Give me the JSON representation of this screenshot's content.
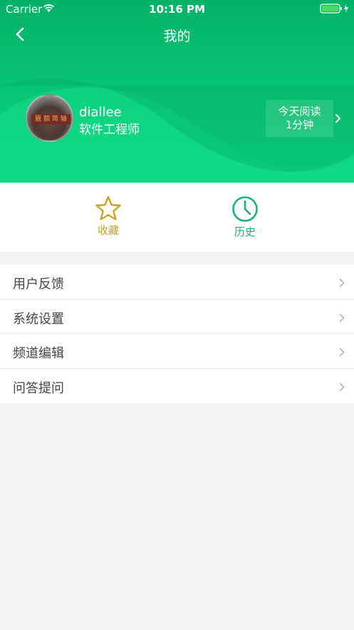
{
  "status_bar": {
    "carrier": "Carrier",
    "time": "10:16 PM"
  },
  "nav": {
    "title": "我的",
    "back_icon": "chevron-left-icon"
  },
  "profile": {
    "username": "diallee",
    "title": "软件工程师",
    "avatar_sign_text": "匾 额 简 轴",
    "reading_label": "今天阅读",
    "reading_value": "1分钟"
  },
  "tabs": [
    {
      "label": "收藏",
      "icon": "star-icon",
      "color": "#c9a227"
    },
    {
      "label": "历史",
      "icon": "clock-icon",
      "color": "#1ab07a"
    }
  ],
  "menu": [
    {
      "label": "用户反馈"
    },
    {
      "label": "系统设置"
    },
    {
      "label": "频道编辑"
    },
    {
      "label": "问答提问"
    }
  ],
  "colors": {
    "header_green": "#05b169",
    "accent_green": "#0ed983",
    "background": "#f4f4f4"
  }
}
